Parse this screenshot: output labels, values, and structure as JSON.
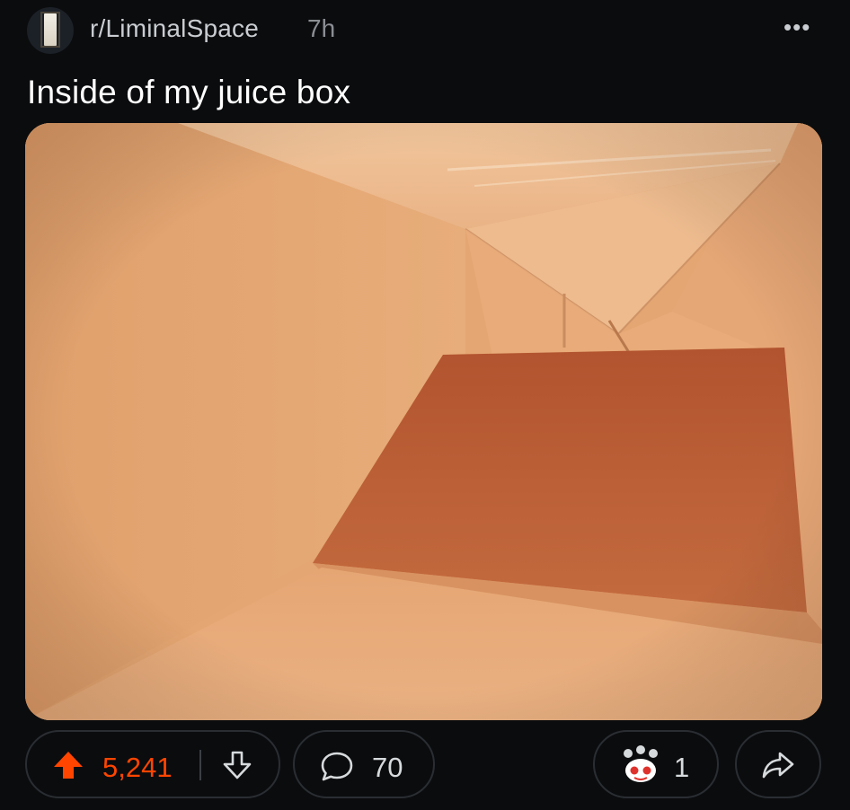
{
  "header": {
    "subreddit": "r/LiminalSpace",
    "age": "7h",
    "more_label": "•••"
  },
  "post": {
    "title": "Inside of my juice box"
  },
  "actions": {
    "score": "5,241",
    "comments": "70",
    "awards": "1"
  },
  "colors": {
    "background": "#0b0c0e",
    "upvote": "#ff4500",
    "pill_border": "#2a2e33",
    "text_muted": "#8b8f94"
  },
  "icons": {
    "avatar": "subreddit-avatar",
    "more": "more-options-icon",
    "upvote": "upvote-arrow-icon",
    "downvote": "downvote-arrow-icon",
    "comment": "speech-bubble-icon",
    "award": "award-icon",
    "share": "share-arrow-icon"
  }
}
